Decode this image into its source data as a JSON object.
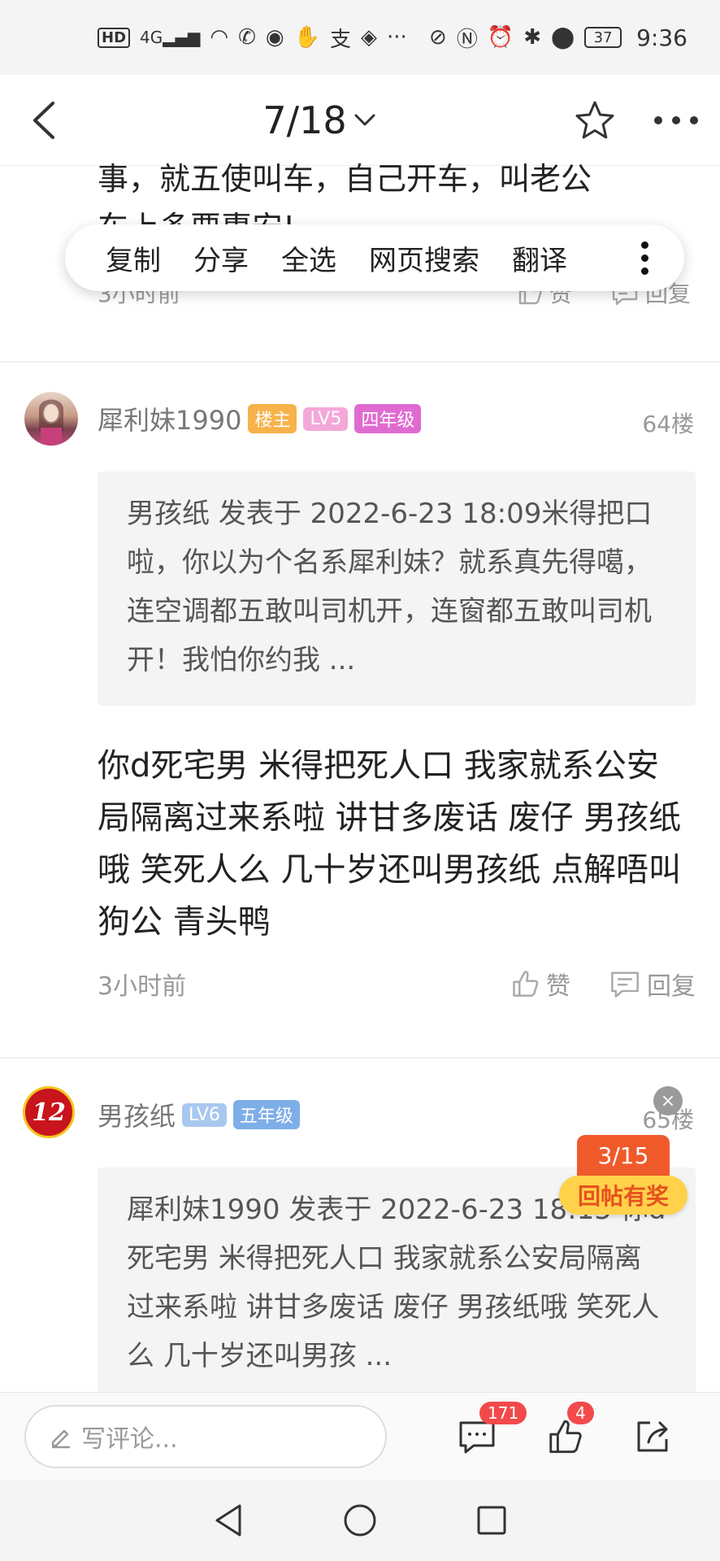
{
  "status": {
    "hd": "HD",
    "signal": "4G",
    "battery": "37",
    "time": "9:36"
  },
  "header": {
    "page": "7/18"
  },
  "partial_post": {
    "text_line1": "事，就五使叫车，自己开车，叫老公",
    "text_line2": "车上多要惠安!",
    "time": "3小时前",
    "like": "赞",
    "reply": "回复"
  },
  "context_menu": {
    "items": [
      "复制",
      "分享",
      "全选",
      "网页搜索",
      "翻译"
    ]
  },
  "post1": {
    "username": "犀利妹1990",
    "badges": [
      "楼主",
      "LV5",
      "四年级"
    ],
    "floor": "64楼",
    "quote": "男孩纸 发表于 2022-6-23 18:09米得把口啦，你以为个名系犀利妹？就系真先得噶，连空调都五敢叫司机开，连窗都五敢叫司机开！我怕你约我 ...",
    "body": "你d死宅男 米得把死人口 我家就系公安局隔离过来系啦 讲甘多废话 废仔 男孩纸哦 笑死人么 几十岁还叫男孩纸 点解唔叫狗公 青头鸭",
    "time": "3小时前",
    "like": "赞",
    "reply": "回复"
  },
  "post2": {
    "username": "男孩纸",
    "avatar_text": "12",
    "badges": [
      "LV6",
      "五年级"
    ],
    "floor": "65楼",
    "quote": "犀利妹1990 发表于 2022-6-23 18:15 你d死宅男 米得把死人口 我家就系公安局隔离过来系啦 讲甘多废话 废仔 男孩纸哦 笑死人么 几十岁还叫男孩 ..."
  },
  "reward": {
    "progress": "3/15",
    "label": "回帖有奖",
    "close": "×"
  },
  "bottom_bar": {
    "placeholder": "写评论...",
    "comment_count": "171",
    "like_count": "4"
  },
  "colors": {
    "owner_badge": "#f7b24a",
    "lv5_badge": "#f3a8d8",
    "grade4_badge": "#e06bd0",
    "lv6_badge": "#a9c8ef",
    "grade5_badge": "#7eaee8",
    "reward_orange": "#f05a2a",
    "reward_yellow": "#ffd24a"
  }
}
